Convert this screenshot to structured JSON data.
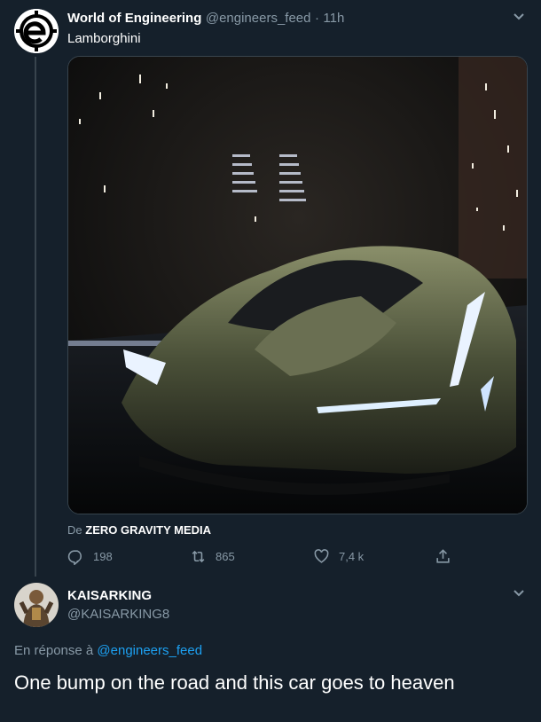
{
  "tweet": {
    "author_name": "World of Engineering",
    "author_handle": "@engineers_feed",
    "separator": "·",
    "time": "11h",
    "text": "Lamborghini",
    "media_credit_prefix": "De",
    "media_credit_name": "ZERO GRAVITY MEDIA",
    "actions": {
      "reply_count": "198",
      "retweet_count": "865",
      "like_count": "7,4 k"
    },
    "icons": [
      "more-chevron-icon",
      "reply-icon",
      "retweet-icon",
      "like-icon",
      "share-icon"
    ]
  },
  "reply": {
    "author_name": "KAISARKING",
    "author_handle": "@KAISARKING8",
    "reply_prefix": "En réponse à",
    "reply_to_handle": "@engineers_feed",
    "text": "One bump on the road and this car goes to heaven"
  },
  "colors": {
    "background": "#15202b",
    "muted_text": "#8899a6",
    "link": "#1da1f2",
    "border": "#38444d"
  }
}
